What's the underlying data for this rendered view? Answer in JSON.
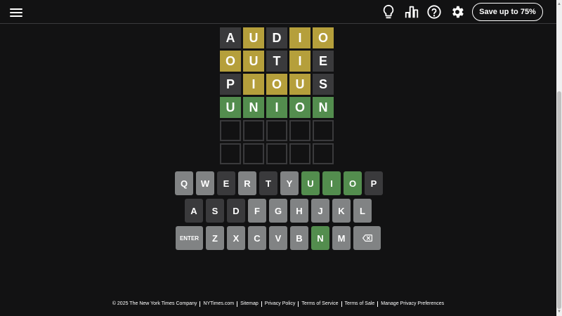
{
  "header": {
    "icons": [
      "menu-icon",
      "lightbulb-icon",
      "stats-icon",
      "help-icon",
      "gear-icon"
    ],
    "save_button_label": "Save up to 75%"
  },
  "board": {
    "rows": [
      [
        {
          "letter": "A",
          "state": "absent"
        },
        {
          "letter": "U",
          "state": "present"
        },
        {
          "letter": "D",
          "state": "absent"
        },
        {
          "letter": "I",
          "state": "present"
        },
        {
          "letter": "O",
          "state": "present"
        }
      ],
      [
        {
          "letter": "O",
          "state": "present"
        },
        {
          "letter": "U",
          "state": "present"
        },
        {
          "letter": "T",
          "state": "absent"
        },
        {
          "letter": "I",
          "state": "present"
        },
        {
          "letter": "E",
          "state": "absent"
        }
      ],
      [
        {
          "letter": "P",
          "state": "absent"
        },
        {
          "letter": "I",
          "state": "present"
        },
        {
          "letter": "O",
          "state": "present"
        },
        {
          "letter": "U",
          "state": "present"
        },
        {
          "letter": "S",
          "state": "absent"
        }
      ],
      [
        {
          "letter": "U",
          "state": "correct"
        },
        {
          "letter": "N",
          "state": "correct"
        },
        {
          "letter": "I",
          "state": "correct"
        },
        {
          "letter": "O",
          "state": "correct"
        },
        {
          "letter": "N",
          "state": "correct"
        }
      ],
      [
        {
          "letter": "",
          "state": "empty"
        },
        {
          "letter": "",
          "state": "empty"
        },
        {
          "letter": "",
          "state": "empty"
        },
        {
          "letter": "",
          "state": "empty"
        },
        {
          "letter": "",
          "state": "empty"
        }
      ],
      [
        {
          "letter": "",
          "state": "empty"
        },
        {
          "letter": "",
          "state": "empty"
        },
        {
          "letter": "",
          "state": "empty"
        },
        {
          "letter": "",
          "state": "empty"
        },
        {
          "letter": "",
          "state": "empty"
        }
      ]
    ]
  },
  "keyboard": {
    "rows": [
      [
        {
          "key": "Q",
          "state": "unused"
        },
        {
          "key": "W",
          "state": "unused"
        },
        {
          "key": "E",
          "state": "absent"
        },
        {
          "key": "R",
          "state": "unused"
        },
        {
          "key": "T",
          "state": "absent"
        },
        {
          "key": "Y",
          "state": "unused"
        },
        {
          "key": "U",
          "state": "correct"
        },
        {
          "key": "I",
          "state": "correct"
        },
        {
          "key": "O",
          "state": "correct"
        },
        {
          "key": "P",
          "state": "absent"
        }
      ],
      [
        {
          "key": "A",
          "state": "absent"
        },
        {
          "key": "S",
          "state": "absent"
        },
        {
          "key": "D",
          "state": "absent"
        },
        {
          "key": "F",
          "state": "unused"
        },
        {
          "key": "G",
          "state": "unused"
        },
        {
          "key": "H",
          "state": "unused"
        },
        {
          "key": "J",
          "state": "unused"
        },
        {
          "key": "K",
          "state": "unused"
        },
        {
          "key": "L",
          "state": "unused"
        }
      ],
      [
        {
          "key": "ENTER",
          "state": "unused",
          "wide": true
        },
        {
          "key": "Z",
          "state": "unused"
        },
        {
          "key": "X",
          "state": "unused"
        },
        {
          "key": "C",
          "state": "unused"
        },
        {
          "key": "V",
          "state": "unused"
        },
        {
          "key": "B",
          "state": "unused"
        },
        {
          "key": "N",
          "state": "correct"
        },
        {
          "key": "M",
          "state": "unused"
        },
        {
          "key": "",
          "icon": "backspace-icon",
          "state": "unused",
          "wide": true
        }
      ]
    ]
  },
  "footer": {
    "links": [
      "© 2025 The New York Times Company",
      "NYTimes.com",
      "Sitemap",
      "Privacy Policy",
      "Terms of Service",
      "Terms of Sale",
      "Manage Privacy Preferences"
    ]
  },
  "colors": {
    "background": "#121213",
    "absent": "#3a3a3c",
    "present": "#b59f3b",
    "correct": "#538d4e",
    "unused_key": "#818384"
  }
}
